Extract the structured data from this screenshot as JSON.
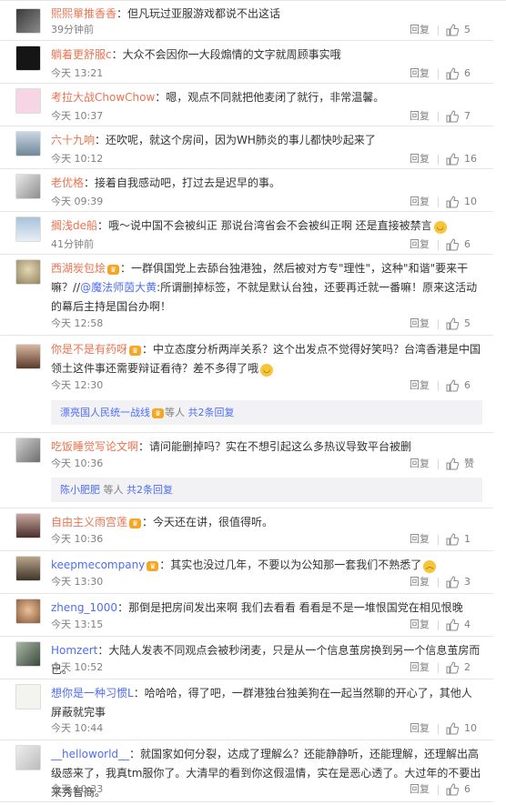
{
  "labels": {
    "reply": "回复",
    "others": "等人",
    "more_replies": "共2条回复"
  },
  "comments": [
    {
      "user": "熙熙單推香香",
      "text": "：但凡玩过亚服游戏都说不出这话",
      "time": "39分钟前",
      "likes": "5"
    },
    {
      "user": "躺着更舒服c",
      "text": "：大众不会因你一大段煽情的文字就周顾事实哦",
      "time": "今天 13:21",
      "likes": "6"
    },
    {
      "user": "考拉大战ChowChow",
      "text": "：嗯，观点不同就把他麦闭了就行，非常温馨。",
      "time": "今天 10:37",
      "likes": "7"
    },
    {
      "user": "六十九响",
      "text": "：还吹呢，就这个房间，因为WH肺炎的事儿都快吵起来了",
      "time": "今天 10:12",
      "likes": "16"
    },
    {
      "user": "老优格",
      "text": "：接着自我感动吧，打过去是迟早的事。",
      "time": "今天 09:39",
      "likes": "10"
    },
    {
      "user": "搁浅de船",
      "text": "：哦～说中国不会被纠正 那说台湾省会不会被纠正啊 还是直接被禁言",
      "time": "41分钟前",
      "likes": "6"
    },
    {
      "user": "西湖炭包烩",
      "text": "：一群俱国党上去舔台独港独，然后被对方专\"理性\"，这种\"和谐\"要来干嘛？//",
      "text_user2": "@魔法师茵大黄",
      "text2": ":所谓删掉标签，不就是默认台独，还要再迁就一番嘛！原来这活动的幕后主持是国台办啊！",
      "time": "今天 12:58",
      "likes": "5"
    },
    {
      "user": "你是不是有药呀",
      "text": "：中立态度分析两岸关系？这个出发点不觉得好笑吗？台湾香港是中国领土这件事还需要辩证看待？差不多得了哦",
      "time": "今天 12:30",
      "likes": "6",
      "sub_user": "漂亮国人民统一战线"
    },
    {
      "user": "吃饭睡觉写论文啊",
      "text": "：请问能删掉吗？实在不想引起这么多热议导致平台被删",
      "time": "今天 10:36",
      "likes": "赞",
      "sub_user": "陈小肥肥"
    },
    {
      "user": "自由主义雨宫莲",
      "text": "：今天还在讲，很值得听。",
      "time": "今天 10:36",
      "likes": "1"
    },
    {
      "user": "keepmecompany",
      "text": "：其实也没过几年，不要以为公知那一套我们不熟悉了",
      "time": "今天 13:30",
      "likes": "3"
    },
    {
      "user": "zheng_1000",
      "text": "：那倒是把房间发出来啊 我们去看看 看看是不是一堆恨国党在相见恨晚",
      "time": "今天 13:15",
      "likes": "4"
    },
    {
      "user": "Homzert",
      "text": "：大陆人发表不同观点会被秒闭麦，只是从一个信息茧房换到另一个信息茧房而已。",
      "time": "今天 10:52",
      "likes": "2"
    },
    {
      "user": "想你是一种习惯L",
      "text": "：哈哈哈，得了吧，一群港独台独美狗在一起当然聊的开心了，其他人屏蔽就完事",
      "time": "今天 10:44",
      "likes": "10"
    },
    {
      "user": "__helloworld__",
      "text": "：就国家如何分裂，达成了理解么？还能静静听，还能理解，还理解出高级感来了，我真tm服你了。大清早的看到你这假温情，实在是恶心透了。大过年的不要出来秀智商。",
      "time": "今天 10:33",
      "likes": "6"
    }
  ]
}
